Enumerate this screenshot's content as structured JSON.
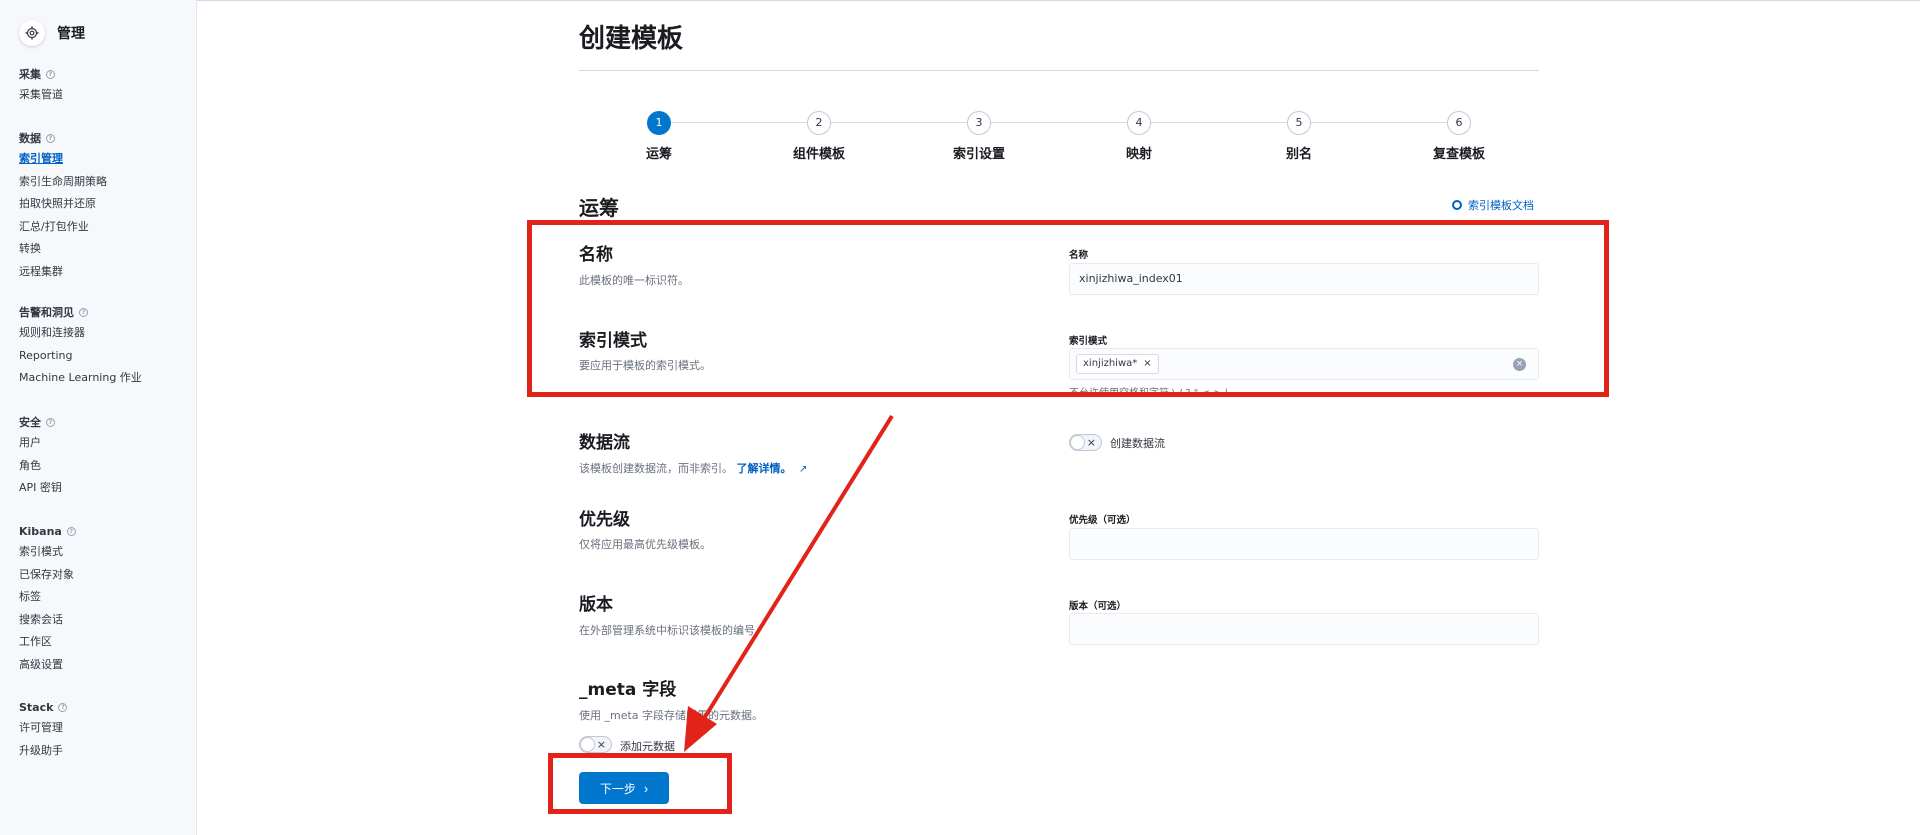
{
  "sidebar": {
    "title": "管理",
    "groups": [
      {
        "label": "采集",
        "items": [
          "采集管道"
        ]
      },
      {
        "label": "数据",
        "items": [
          "索引管理",
          "索引生命周期策略",
          "拍取快照并还原",
          "汇总/打包作业",
          "转换",
          "远程集群"
        ]
      },
      {
        "label": "告警和洞见",
        "items": [
          "规则和连接器",
          "Reporting",
          "Machine Learning 作业"
        ]
      },
      {
        "label": "安全",
        "items": [
          "用户",
          "角色",
          "API 密钥"
        ]
      },
      {
        "label": "Kibana",
        "items": [
          "索引模式",
          "已保存对象",
          "标签",
          "搜索会话",
          "工作区",
          "高级设置"
        ]
      },
      {
        "label": "Stack",
        "items": [
          "许可管理",
          "升级助手"
        ]
      }
    ]
  },
  "page": {
    "title": "创建模板"
  },
  "steps": [
    {
      "num": "1",
      "label": "运筹",
      "active": true
    },
    {
      "num": "2",
      "label": "组件模板"
    },
    {
      "num": "3",
      "label": "索引设置"
    },
    {
      "num": "4",
      "label": "映射"
    },
    {
      "num": "5",
      "label": "别名"
    },
    {
      "num": "6",
      "label": "复查模板"
    }
  ],
  "section": {
    "title": "运筹",
    "doc_link": "索引模板文档"
  },
  "fields": {
    "name": {
      "title": "名称",
      "desc": "此模板的唯一标识符。",
      "label": "名称",
      "value": "xinjizhiwa_index01"
    },
    "pattern": {
      "title": "索引模式",
      "desc": "要应用于模板的索引模式。",
      "label": "索引模式",
      "pill": "xinjizhiwa*",
      "help": "不允许使用空格和字符 \\ / ? \" < > |"
    },
    "datastream": {
      "title": "数据流",
      "desc": "该模板创建数据流，而非索引。",
      "link": "了解详情。",
      "switch_label": "创建数据流"
    },
    "priority": {
      "title": "优先级",
      "desc": "仅将应用最高优先级模板。",
      "label": "优先级（可选）"
    },
    "version": {
      "title": "版本",
      "desc": "在外部管理系统中标识该模板的编号。",
      "label": "版本（可选）"
    },
    "meta": {
      "title": "_meta 字段",
      "desc": "使用 _meta 字段存储所需的元数据。",
      "switch_label": "添加元数据"
    }
  },
  "buttons": {
    "next": "下一步"
  },
  "colors": {
    "accent": "#0077cc",
    "annotation": "#e2231a"
  }
}
